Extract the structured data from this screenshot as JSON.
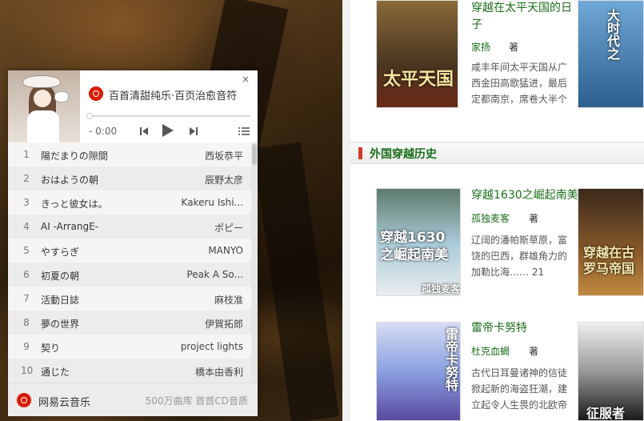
{
  "player": {
    "playlist_title": "百首清甜纯乐·百页治愈音符",
    "close_label": "×",
    "time": "- 0:00",
    "tracks": [
      {
        "num": "1",
        "song": "陽だまりの隙間",
        "artist": "西坂恭平"
      },
      {
        "num": "2",
        "song": "おはようの朝",
        "artist": "辰野太彦"
      },
      {
        "num": "3",
        "song": "きっと彼女は。",
        "artist": "Kakeru Ishi..."
      },
      {
        "num": "4",
        "song": "AI -ArrangE-",
        "artist": "ポピー"
      },
      {
        "num": "5",
        "song": "やすらぎ",
        "artist": "MANYO"
      },
      {
        "num": "6",
        "song": "初夏の朝",
        "artist": "Peak A So..."
      },
      {
        "num": "7",
        "song": "活動日誌",
        "artist": "麻枝准"
      },
      {
        "num": "8",
        "song": "夢の世界",
        "artist": "伊賀拓郎"
      },
      {
        "num": "9",
        "song": "契り",
        "artist": "project lights"
      },
      {
        "num": "10",
        "song": "通じた",
        "artist": "橋本由香利"
      }
    ],
    "brand": "网易云音乐",
    "slogan": "500万曲库 首首CD音质"
  },
  "books": {
    "top": {
      "title": "穿越在太平天国的日子",
      "author": "家扬",
      "zhu": "著",
      "desc": "咸丰年间太平天国从广西金田高歌猛进，最后定都南京，席卷大半个",
      "cover_text": "太平天国",
      "side_cover_text": "大时代之"
    },
    "section_title": "外国穿越历史",
    "book2": {
      "title": "穿越1630之崛起南美",
      "author": "孤独麦客",
      "zhu": "著",
      "desc": "辽阔的潘帕斯草原，富饶的巴西，群雄角力的加勒比海……",
      "count": "21",
      "cover_text": "穿越1630之崛起南美",
      "cover_author": "孤独麦客",
      "side_cover_text": "穿越在古罗马帝国"
    },
    "book3": {
      "title": "雷帝卡努特",
      "author": "杜克血蝎",
      "zhu": "著",
      "desc": "古代日耳曼诸神的信徒掀起新的海盗狂潮，建立起令人生畏的北欧帝",
      "cover_text": "雷帝卡努特",
      "side_cover_text": "征服者"
    }
  }
}
